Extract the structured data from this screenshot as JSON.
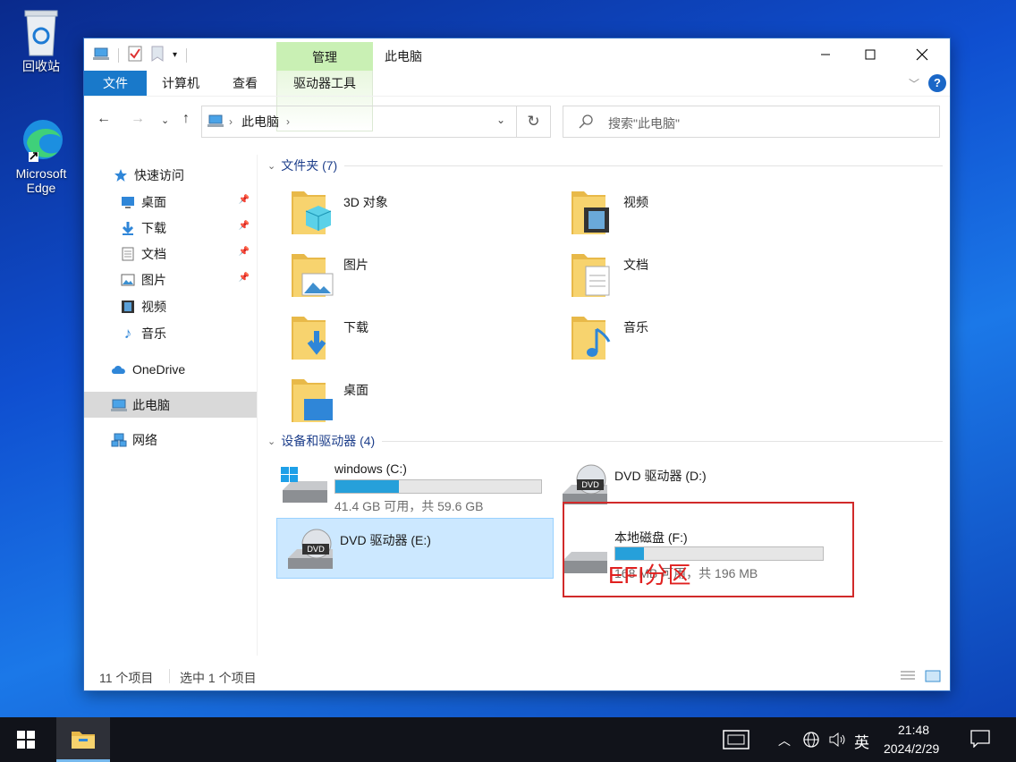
{
  "desktop": {
    "recycle_bin": "回收站",
    "edge_line1": "Microsoft",
    "edge_line2": "Edge"
  },
  "window": {
    "title": "此电脑",
    "contextual_tab": "管理",
    "ribbon_tabs": [
      "文件",
      "计算机",
      "查看",
      "驱动器工具"
    ]
  },
  "nav": {
    "breadcrumb": "此电脑",
    "search_placeholder": "搜索\"此电脑\""
  },
  "sidebar": {
    "quick_access": "快速访问",
    "items": [
      "桌面",
      "下载",
      "文档",
      "图片",
      "视频",
      "音乐"
    ],
    "onedrive": "OneDrive",
    "this_pc": "此电脑",
    "network": "网络"
  },
  "folders_group": "文件夹 (7)",
  "folders": [
    "3D 对象",
    "视频",
    "图片",
    "文档",
    "下载",
    "音乐",
    "桌面"
  ],
  "devices_group": "设备和驱动器 (4)",
  "drives": [
    {
      "name": "windows (C:)",
      "size": "41.4 GB 可用，共 59.6 GB",
      "used_fraction": 0.31
    },
    {
      "name": "DVD 驱动器 (D:)"
    },
    {
      "name": "DVD 驱动器 (E:)"
    },
    {
      "name": "本地磁盘 (F:)",
      "size": "168 MB 可用，共 196 MB",
      "used_fraction": 0.14
    }
  ],
  "annotation": "EFI分区",
  "status": {
    "count": "11 个项目",
    "selected": "选中 1 个项目"
  },
  "taskbar": {
    "ime": "英",
    "time": "21:48",
    "date": "2024/2/29"
  },
  "colors": {
    "accent": "#1979ca",
    "annotation": "#e0201f",
    "drive_fill": "#26a0da"
  }
}
